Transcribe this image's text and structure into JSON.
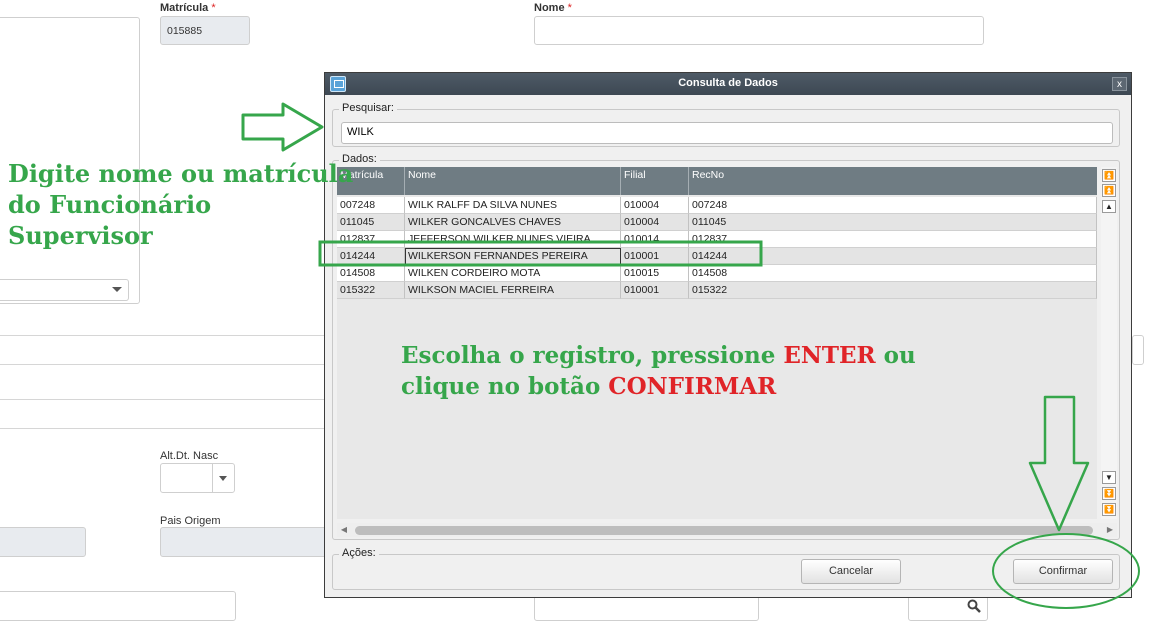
{
  "background_form": {
    "matricula_label": "Matrícula",
    "required_mark": "*",
    "matricula_value": "015885",
    "nome_label": "Nome",
    "alt_dt_nasc_label": "Alt.Dt. Nasc",
    "pais_origem_label": "Pais Origem"
  },
  "dialog": {
    "title": "Consulta de Dados",
    "close_label": "x",
    "search_group_label": "Pesquisar:",
    "search_value": "WILK",
    "data_group_label": "Dados:",
    "columns": [
      "Matrícula",
      "Nome",
      "Filial",
      "RecNo"
    ],
    "rows": [
      {
        "matricula": "007248",
        "nome": "WILK RALFF DA SILVA NUNES",
        "filial": "010004",
        "recno": "007248"
      },
      {
        "matricula": "011045",
        "nome": "WILKER GONCALVES CHAVES",
        "filial": "010004",
        "recno": "011045"
      },
      {
        "matricula": "012837",
        "nome": "JEFFERSON WILKER NUNES VIEIRA",
        "filial": "010014",
        "recno": "012837"
      },
      {
        "matricula": "014244",
        "nome": "WILKERSON FERNANDES PEREIRA",
        "filial": "010001",
        "recno": "014244"
      },
      {
        "matricula": "014508",
        "nome": "WILKEN CORDEIRO MOTA",
        "filial": "010015",
        "recno": "014508"
      },
      {
        "matricula": "015322",
        "nome": "WILKSON MACIEL FERREIRA",
        "filial": "010001",
        "recno": "015322"
      }
    ],
    "actions_group_label": "Ações:",
    "cancel_label": "Cancelar",
    "confirm_label": "Confirmar"
  },
  "annotations": {
    "left_text_line1": "Digite nome ou matrícula",
    "left_text_line2": "do Funcionário",
    "left_text_line3": "Supervisor",
    "center_part1": "Escolha o registro, pressione ",
    "center_enter": "ENTER",
    "center_part2": " ou",
    "center_part3": "clique no botão ",
    "center_confirmar": "CONFIRMAR"
  },
  "colors": {
    "annotation_green": "#36a64b",
    "annotation_red": "#e02428",
    "grid_header": "#6f7c83",
    "titlebar": "#3d4853"
  }
}
